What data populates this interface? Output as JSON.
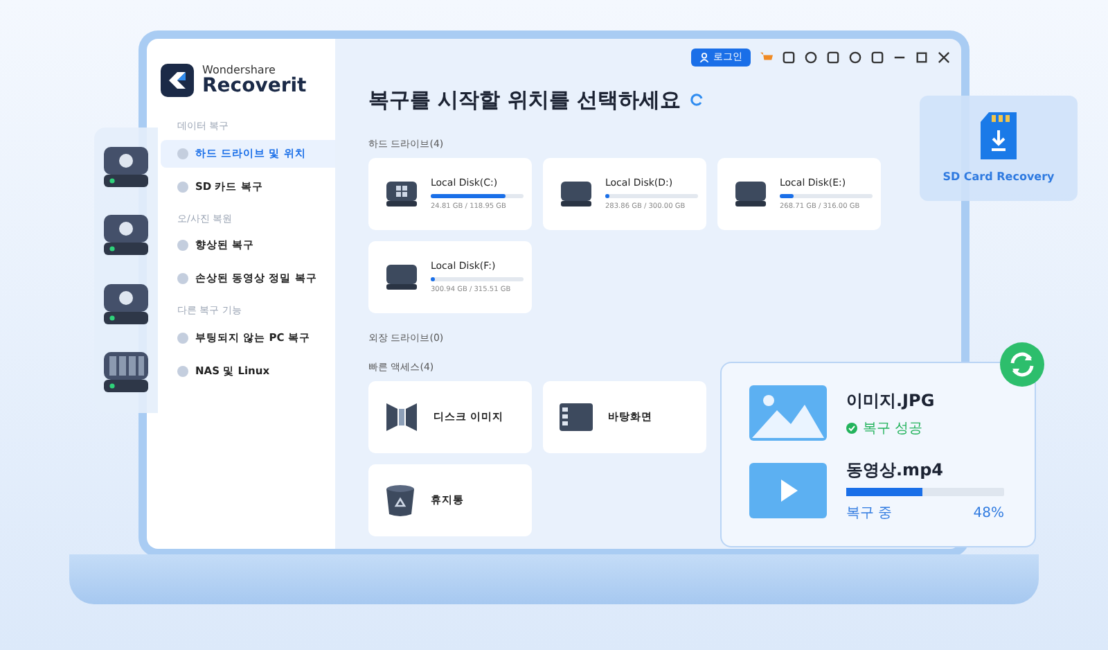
{
  "app": {
    "brand": "Wondershare",
    "name": "Recoverit"
  },
  "sidebar": {
    "sections": [
      {
        "title": "데이터 복구",
        "items": [
          {
            "label": "하드 드라이브 및 위치",
            "selected": true
          },
          {
            "label": "SD 카드 복구",
            "selected": false
          }
        ]
      },
      {
        "title": "오/사진 복원",
        "items": [
          {
            "label": "향상된 복구",
            "selected": false
          },
          {
            "label": "손상된 동영상 정밀 복구",
            "selected": false
          }
        ]
      },
      {
        "title": "다른 복구 기능",
        "items": [
          {
            "label": "부팅되지 않는 PC 복구",
            "selected": false
          },
          {
            "label": "NAS 및 Linux",
            "selected": false
          }
        ]
      }
    ]
  },
  "toolbar": {
    "login": "로그인"
  },
  "title": "복구를 시작할 위치를 선택하세요",
  "hard_drives": {
    "heading": "하드 드라이브(4)",
    "drives": [
      {
        "name": "Local Disk(C:)",
        "kind": "windows",
        "level": 0.8,
        "size": "24.81 GB / 118.95 GB"
      },
      {
        "name": "Local Disk(D:)",
        "kind": "plain",
        "level": 0.05,
        "size": "283.86 GB / 300.00 GB"
      },
      {
        "name": "Local Disk(E:)",
        "kind": "plain",
        "level": 0.15,
        "size": "268.71 GB / 316.00 GB"
      },
      {
        "name": "Local Disk(F:)",
        "kind": "plain",
        "level": 0.05,
        "size": "300.94 GB / 315.51 GB"
      }
    ]
  },
  "external_drives": {
    "heading": "외장 드라이브(0)"
  },
  "quick_access": {
    "heading": "빠른 액세스(4)",
    "items": [
      {
        "label": "디스크 이미지",
        "kind": "disk-image"
      },
      {
        "label": "바탕화면",
        "kind": "desktop"
      },
      {
        "label": "휴지통",
        "kind": "trash"
      }
    ]
  },
  "sd_card": {
    "label": "SD Card Recovery"
  },
  "recovery": {
    "files": [
      {
        "name": "이미지.JPG",
        "kind": "image",
        "status": "복구 성공",
        "done": true
      },
      {
        "name": "동영상.mp4",
        "kind": "video",
        "status": "복구 중",
        "done": false,
        "level": 0.48,
        "percent": "48%"
      }
    ]
  }
}
